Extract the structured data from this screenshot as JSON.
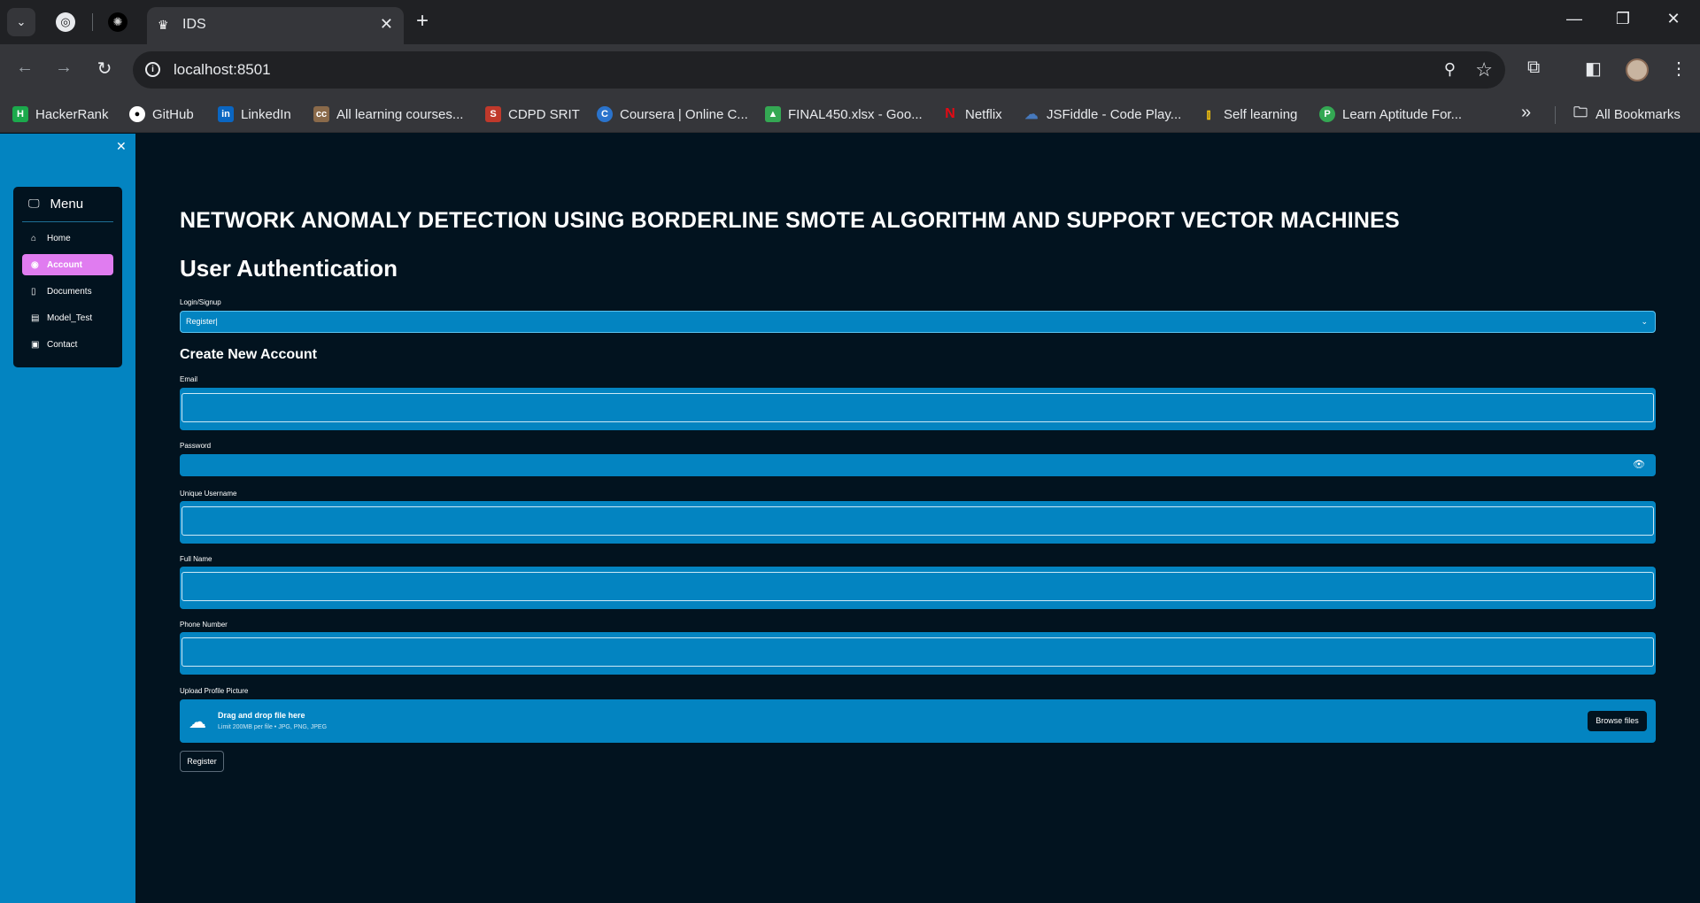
{
  "browser": {
    "tab_title": "IDS",
    "url": "localhost:8501",
    "bookmarks": [
      {
        "label": "HackerRank",
        "icon": "hackerrank-icon",
        "color": "#1ba94c"
      },
      {
        "label": "GitHub",
        "icon": "github-icon",
        "color": "#ffffff"
      },
      {
        "label": "LinkedIn",
        "icon": "linkedin-icon",
        "color": "#0a66c2"
      },
      {
        "label": "All learning courses...",
        "icon": "cc-icon",
        "color": "#8a6a4a"
      },
      {
        "label": "CDPD SRIT",
        "icon": "srit-icon",
        "color": "#c0392b"
      },
      {
        "label": "Coursera | Online C...",
        "icon": "coursera-icon",
        "color": "#2a73cc"
      },
      {
        "label": "FINAL450.xlsx - Goo...",
        "icon": "google-drive-icon",
        "color": "#34a853"
      },
      {
        "label": "Netflix",
        "icon": "netflix-icon",
        "color": "#e50914"
      },
      {
        "label": "JSFiddle - Code Play...",
        "icon": "jsfiddle-icon",
        "color": "#4679bd"
      },
      {
        "label": "Self learning",
        "icon": "bookmark-bars-icon",
        "color": "#f4c20d"
      },
      {
        "label": "Learn Aptitude For...",
        "icon": "aptitude-icon",
        "color": "#34a853"
      }
    ],
    "all_bookmarks": "All Bookmarks"
  },
  "sidebar": {
    "menu_title": "Menu",
    "items": [
      {
        "label": "Home",
        "icon": "home-icon",
        "active": false
      },
      {
        "label": "Account",
        "icon": "account-icon",
        "active": true
      },
      {
        "label": "Documents",
        "icon": "document-icon",
        "active": false
      },
      {
        "label": "Model_Test",
        "icon": "model-icon",
        "active": false
      },
      {
        "label": "Contact",
        "icon": "contact-icon",
        "active": false
      }
    ]
  },
  "main": {
    "title": "NETWORK ANOMALY DETECTION USING BORDERLINE SMOTE ALGORITHM AND SUPPORT VECTOR MACHINES",
    "subtitle": "User Authentication",
    "select_label": "Login/Signup",
    "select_value": "Register",
    "section": "Create New Account",
    "email_label": "Email",
    "password_label": "Password",
    "username_label": "Unique Username",
    "fullname_label": "Full Name",
    "phone_label": "Phone Number",
    "upload_label": "Upload Profile Picture",
    "upload_title": "Drag and drop file here",
    "upload_limit": "Limit 200MB per file • JPG, PNG, JPEG",
    "browse_label": "Browse files",
    "register_label": "Register"
  },
  "colors": {
    "sidebar": "#0384c1",
    "background": "#02131f",
    "active_item": "#e07cf0"
  }
}
